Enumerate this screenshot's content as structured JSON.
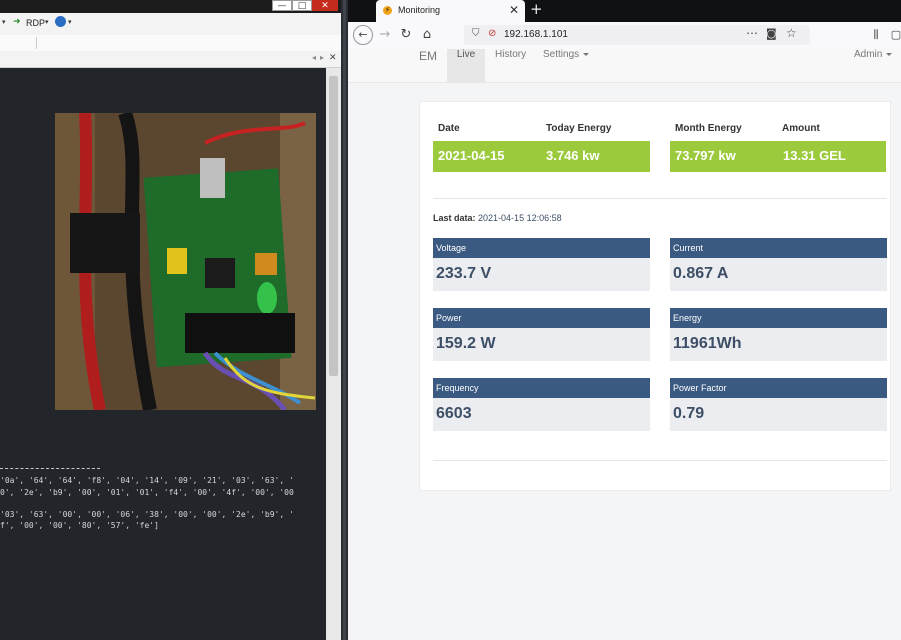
{
  "left_window": {
    "controls": {
      "minimize": "—",
      "maximize": "□",
      "close": "✕"
    },
    "toolbar": {
      "rdp_label": "RDP"
    },
    "code_lines": [
      "'0a', '64', '64', 'f8', '04', '14', '09', '21', '03', '63', '",
      "0', '2e', 'b9', '00', '01', '01', 'f4', '00', '4f', '00', '00",
      "'03', '63', '00', '00', '06', '38', '00', '00', '2e', 'b9', '",
      "f', '00', '00', '80', '57', 'fe']"
    ]
  },
  "browser": {
    "tab": {
      "title": "Monitoring",
      "close": "✕",
      "new_tab": "+"
    },
    "url": "192.168.1.101"
  },
  "nav": {
    "brand": "EM",
    "links": [
      "Live",
      "History",
      "Settings"
    ],
    "admin": "Admin"
  },
  "summary": {
    "headers": [
      "Date",
      "Today Energy",
      "Month Energy",
      "Amount"
    ],
    "values": [
      "2021-04-15",
      "3.746 kw",
      "73.797 kw",
      "13.31 GEL"
    ]
  },
  "last_data": {
    "label": "Last data:",
    "value": "2021-04-15 12:06:58"
  },
  "metrics": [
    {
      "label": "Voltage",
      "value": "233.7 V"
    },
    {
      "label": "Current",
      "value": "0.867 A"
    },
    {
      "label": "Power",
      "value": "159.2 W"
    },
    {
      "label": "Energy",
      "value": "11961Wh"
    },
    {
      "label": "Frequency",
      "value": "6603"
    },
    {
      "label": "Power Factor",
      "value": "0.79"
    }
  ],
  "colors": {
    "green_band": "#9bcb3c",
    "metric_header": "#3b5a82"
  }
}
